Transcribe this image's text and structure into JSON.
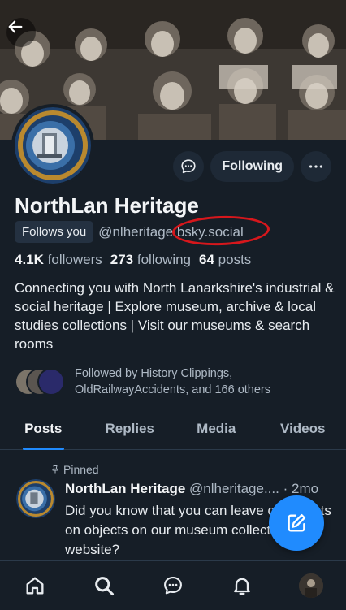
{
  "profile": {
    "display_name": "NorthLan Heritage",
    "follows_you": "Follows you",
    "handle": "@nlheritage.bsky.social",
    "followers_count": "4.1K",
    "followers_label": "followers",
    "following_count": "273",
    "following_label": "following",
    "posts_count": "64",
    "posts_label": "posts",
    "bio": "Connecting you with North Lanarkshire's industrial & social heritage | Explore museum, archive & local studies collections | Visit our museums & search rooms",
    "followed_by": "Followed by History Clippings, OldRailwayAccidents, and 166 others"
  },
  "actions": {
    "following_label": "Following"
  },
  "tabs": [
    {
      "label": "Posts"
    },
    {
      "label": "Replies"
    },
    {
      "label": "Media"
    },
    {
      "label": "Videos"
    }
  ],
  "post": {
    "pinned_label": "Pinned",
    "author": "NorthLan Heritage",
    "handle": "@nlheritage....",
    "sep": "·",
    "time": "2mo",
    "text": "Did you know that you can leave comments on objects on our museum collections website?"
  },
  "colors": {
    "accent": "#208bfe",
    "annotation": "#d6171c",
    "background": "#161e27"
  },
  "icons": [
    "back-arrow-icon",
    "chat-icon",
    "more-icon",
    "pin-icon",
    "compose-icon",
    "home-icon",
    "search-icon",
    "chat-nav-icon",
    "bell-icon"
  ]
}
